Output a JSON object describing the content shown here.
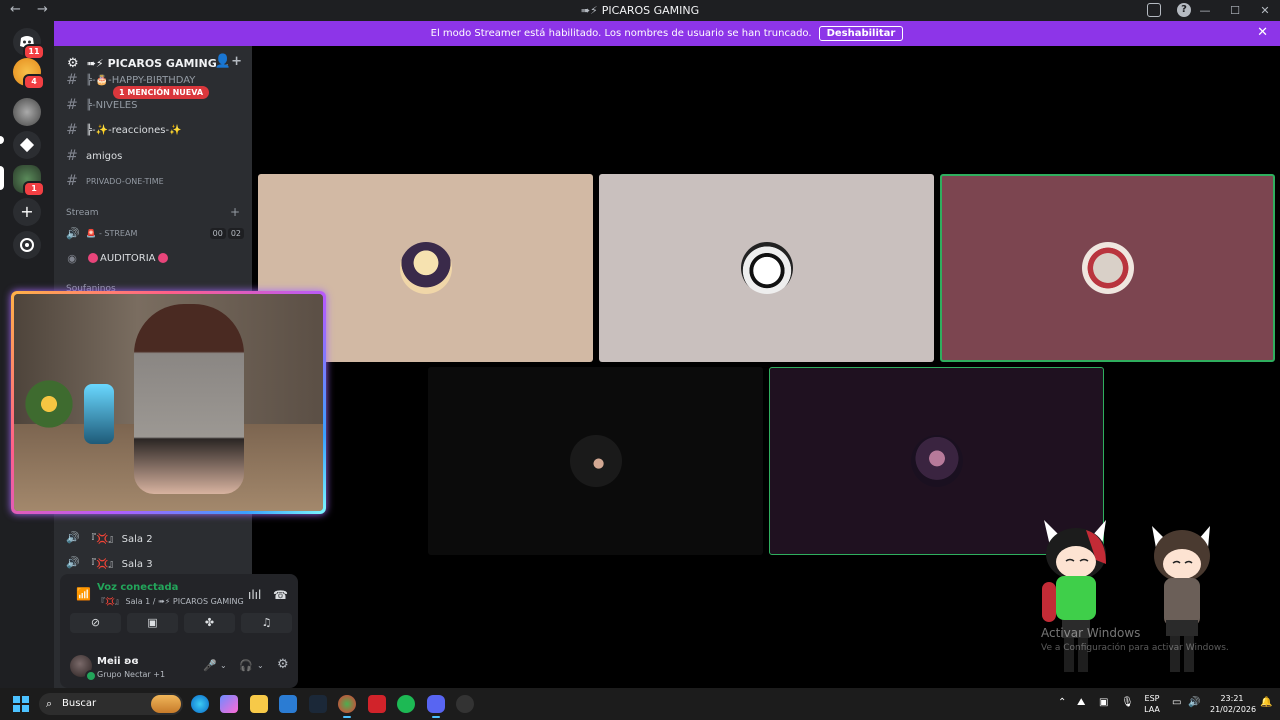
{
  "window": {
    "title": "PICAROS GAMING",
    "nav": "← →",
    "minimize": "—",
    "maximize": "☐",
    "close": "✕"
  },
  "banner": {
    "text": "El modo Streamer está habilitado. Los nombres de usuario se han truncado.",
    "button": "Deshabilitar",
    "close": "✕"
  },
  "guilds": {
    "badges": [
      "11",
      "4",
      "",
      "",
      "1"
    ]
  },
  "server": {
    "name": "PICAROS GAMING"
  },
  "channels": [
    {
      "name": "╠-🎂-HAPPY-BIRTHDAY"
    },
    {
      "name": "╠-NIVELES"
    },
    {
      "name": "╠-✨-reacciones-✨"
    },
    {
      "name": "amigos"
    },
    {
      "name": "PRIVADO-ONE-TIME"
    }
  ],
  "mention_pill": "1 MENCIÓN NUEVA",
  "categories": {
    "stream": "Stream",
    "hidden": "Soufaninos"
  },
  "voice_channels": {
    "stream": {
      "name": "- STREAM",
      "chip1": "00",
      "chip2": "02"
    },
    "auditoria": {
      "name": "AUDITORIA"
    },
    "sala2": {
      "name": "『💢』 Sala 2"
    },
    "sala3": {
      "name": "『💢』 Sala 3"
    }
  },
  "voice_panel": {
    "status": "Voz conectada",
    "location": "『💢』 Sala 1 / ➠⚡ PICAROS GAMING"
  },
  "user": {
    "name": "Meii ʚɞ",
    "status_text": "Grupo Nectar +1"
  },
  "watermark": {
    "line1": "Activar Windows",
    "line2": "Ve a Configuración para activar Windows."
  },
  "taskbar": {
    "search_placeholder": "Buscar",
    "lang1": "ESP",
    "lang2": "LAA",
    "time": "23:21",
    "date": "21/02/2026"
  },
  "colors": {
    "banner": "#8d35e8",
    "green": "#23a55a",
    "mention": "#da373c",
    "tile1": "#d2b9a4",
    "tile2": "#c9c0be",
    "tile3": "#7c4550",
    "tile4": "#0b0b0b",
    "tile5": "#1f1120"
  }
}
